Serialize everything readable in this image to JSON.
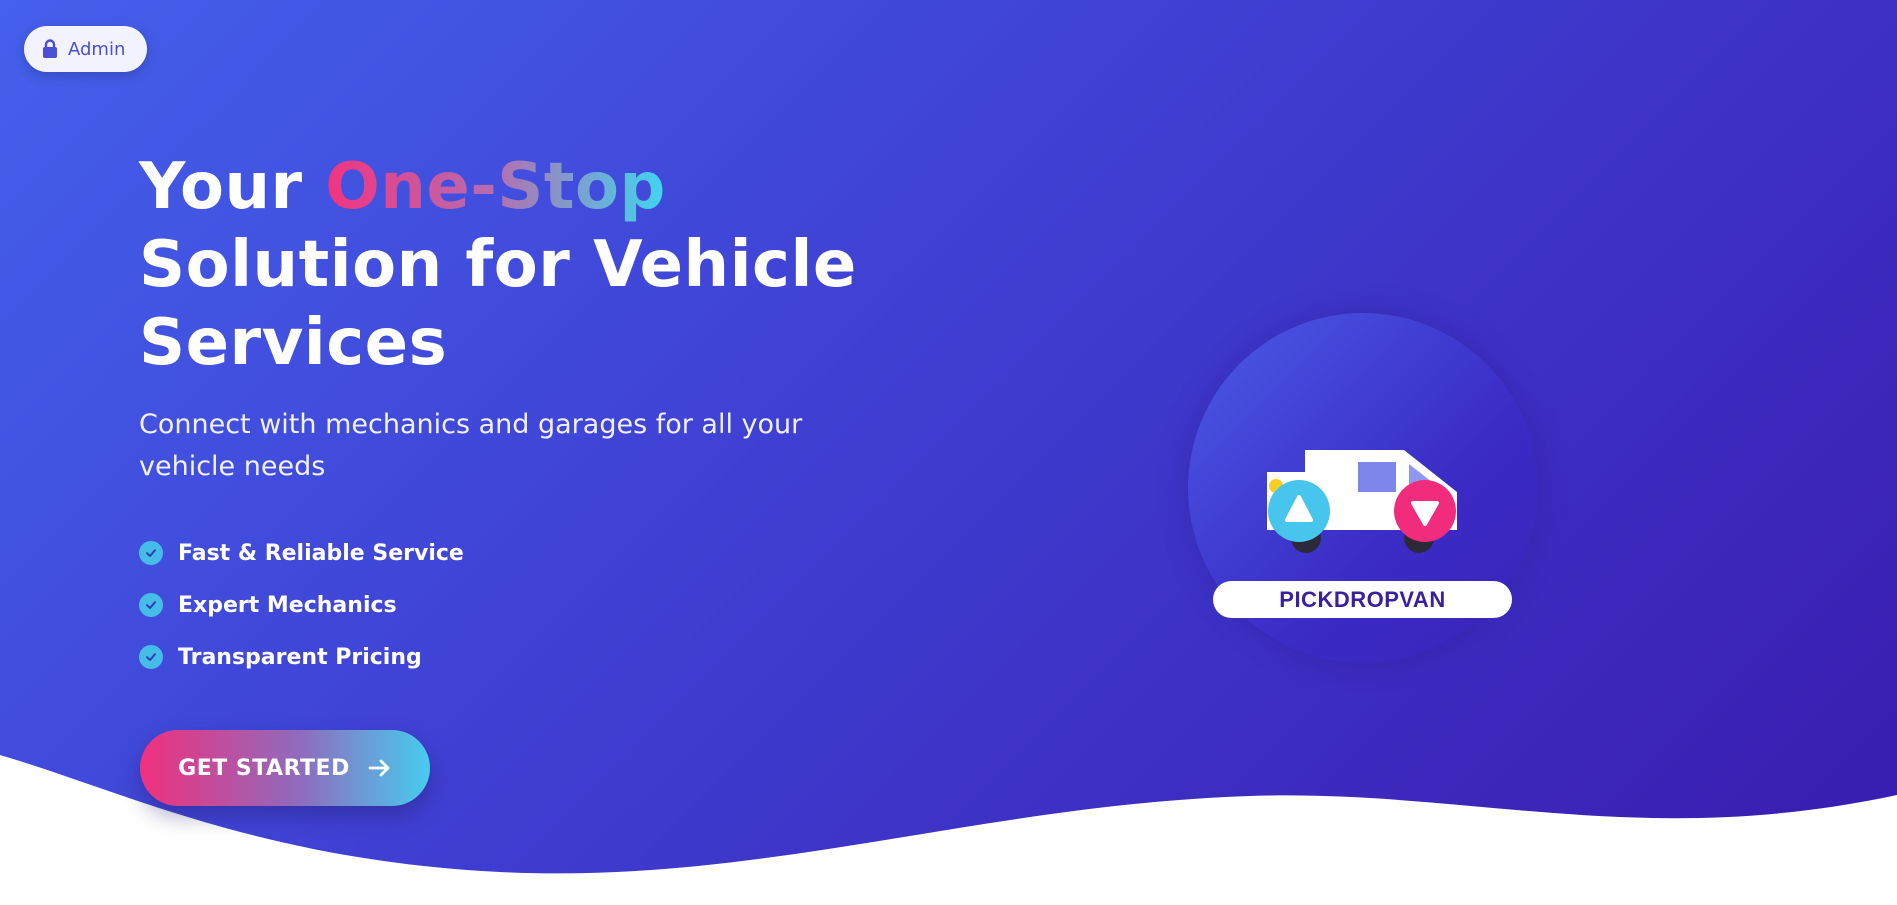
{
  "header": {
    "admin_label": "Admin"
  },
  "hero": {
    "headline_prefix": "Your",
    "headline_highlight": "One-Stop",
    "headline_suffix": "Solution for Vehicle Services",
    "subtitle": "Connect with mechanics and garages for all your vehicle needs",
    "features": [
      "Fast & Reliable Service",
      "Expert Mechanics",
      "Transparent Pricing"
    ],
    "cta_label": "GET STARTED"
  },
  "illustration": {
    "brand_label": "PICKDROPVAN"
  },
  "icons": {
    "admin": "lock-icon",
    "feature": "check-circle-icon",
    "cta": "arrow-right-icon",
    "pickup": "pickup-up-arrow-icon",
    "dropoff": "dropoff-down-arrow-icon",
    "vehicle": "van-icon"
  },
  "colors": {
    "background_start": "#4460ec",
    "background_end": "#3a1aae",
    "accent_pink": "#f1307d",
    "accent_cyan": "#47ccef",
    "brand_text": "#3b1fa3"
  }
}
